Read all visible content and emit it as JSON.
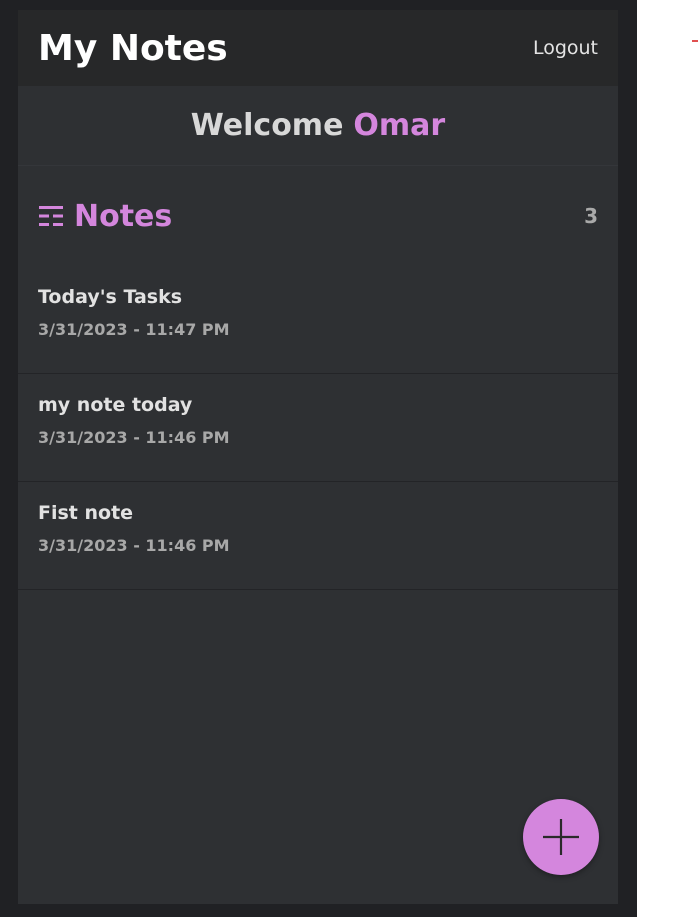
{
  "header": {
    "title": "My Notes",
    "logout_label": "Logout"
  },
  "welcome": {
    "greeting": "Welcome",
    "user_name": "Omar"
  },
  "notes_section": {
    "heading": "Notes",
    "icon": "list-icon",
    "count": "3"
  },
  "notes": [
    {
      "title": "Today's Tasks",
      "date": "3/31/2023 - 11:47 PM"
    },
    {
      "title": "my note today",
      "date": "3/31/2023 - 11:46 PM"
    },
    {
      "title": "Fist note",
      "date": "3/31/2023 - 11:46 PM"
    }
  ],
  "fab": {
    "icon": "plus-icon"
  },
  "colors": {
    "accent": "#d486dd",
    "panel_bg": "#2e3033",
    "topbar_bg": "#272829",
    "frame_bg": "#202124"
  }
}
